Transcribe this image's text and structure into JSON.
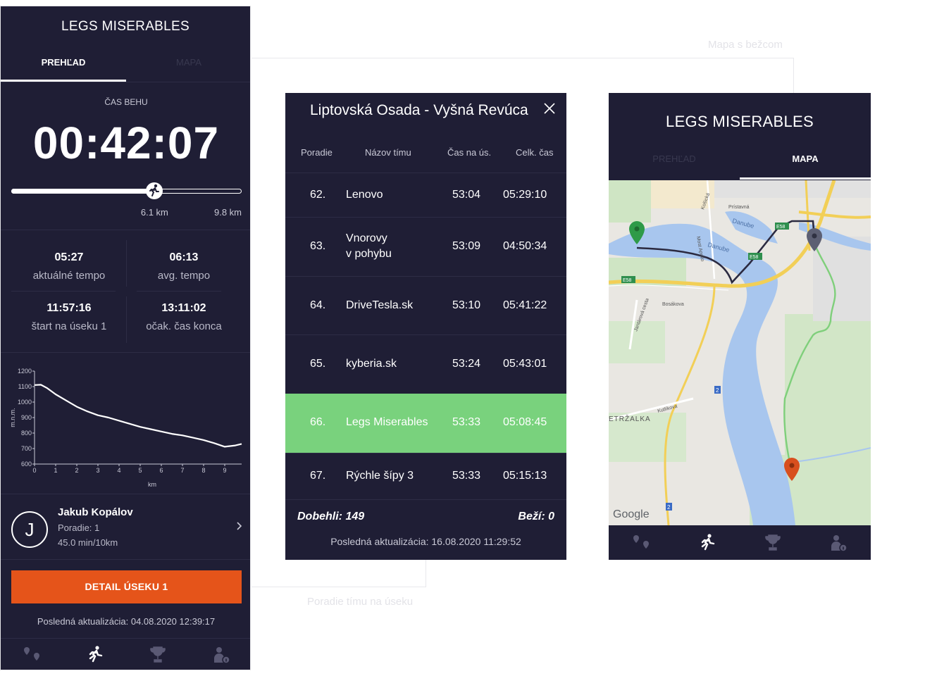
{
  "annotations": {
    "map_label": "Mapa s bežcom",
    "ranking_label": "Poradie tímu na úseku"
  },
  "overview": {
    "title": "LEGS MISERABLES",
    "tabs": [
      "PREHĽAD",
      "MAPA"
    ],
    "run_time_label": "ČAS BEHU",
    "run_time": "00:42:07",
    "progress": {
      "current_km_label": "6.1 km",
      "total_km_label": "9.8 km",
      "fraction": 0.622
    },
    "stats": {
      "pace_current": "05:27",
      "pace_current_label": "aktuálné tempo",
      "pace_avg": "06:13",
      "pace_avg_label": "avg. tempo",
      "start_time": "11:57:16",
      "start_time_label": "štart na úseku 1",
      "expected_end": "13:11:02",
      "expected_end_label": "očak. čas konca"
    },
    "runner": {
      "initial": "J",
      "name": "Jakub Kopálov",
      "rank": "Poradie: 1",
      "pace": "45.0 min/10km"
    },
    "detail_button": "DETAIL ÚSEKU 1",
    "last_update": "Posledná aktualizácia: 04.08.2020 12:39:17",
    "nav_icons": [
      "pins-icon",
      "runner-icon",
      "trophy-icon",
      "person-info-icon"
    ],
    "active_nav": 1
  },
  "chart_data": {
    "type": "line",
    "xlabel": "km",
    "ylabel": "m.n.m.",
    "xlim": [
      0,
      9.8
    ],
    "ylim": [
      600,
      1200
    ],
    "x_ticks": [
      0,
      1,
      2,
      3,
      4,
      5,
      6,
      7,
      8,
      9
    ],
    "y_ticks": [
      600,
      700,
      800,
      900,
      1000,
      1100,
      1200
    ],
    "x": [
      0,
      0.3,
      0.6,
      1,
      1.5,
      2,
      2.5,
      3,
      3.5,
      4,
      4.5,
      5,
      5.5,
      6,
      6.5,
      7,
      7.5,
      8,
      8.5,
      9,
      9.5,
      9.8
    ],
    "values": [
      1110,
      1112,
      1090,
      1050,
      1010,
      970,
      940,
      915,
      900,
      880,
      860,
      840,
      825,
      810,
      795,
      785,
      770,
      755,
      735,
      712,
      720,
      730
    ]
  },
  "ranking": {
    "title": "Liptovská Osada - Vyšná Revúca",
    "headers": [
      "Poradie",
      "Názov tímu",
      "Čas na ús.",
      "Celk. čas"
    ],
    "rows": [
      {
        "rank": "62.",
        "team": "Lenovo",
        "team2": "",
        "segment": "53:04",
        "total": "05:29:10",
        "highlight": false
      },
      {
        "rank": "63.",
        "team": "Vnorovy",
        "team2": "v pohybu",
        "segment": "53:09",
        "total": "04:50:34",
        "highlight": false
      },
      {
        "rank": "64.",
        "team": "DriveTesla.sk",
        "team2": "",
        "segment": "53:10",
        "total": "05:41:22",
        "highlight": false
      },
      {
        "rank": "65.",
        "team": "kyberia.sk",
        "team2": "",
        "segment": "53:24",
        "total": "05:43:01",
        "highlight": false
      },
      {
        "rank": "66.",
        "team": "Legs Miserables",
        "team2": "",
        "segment": "53:33",
        "total": "05:08:45",
        "highlight": true
      },
      {
        "rank": "67.",
        "team": "Rýchle šípy 3",
        "team2": "",
        "segment": "53:33",
        "total": "05:15:13",
        "highlight": false
      }
    ],
    "finished": "Dobehli: 149",
    "running": "Beží: 0",
    "last_update": "Posledná aktualizácia: 16.08.2020 11:29:52"
  },
  "map_view": {
    "title": "LEGS MISERABLES",
    "tabs": [
      "PREHĽAD",
      "MAPA"
    ],
    "labels": {
      "pristavna": "Prístavná",
      "danube1": "Danube",
      "danube2": "Danube",
      "e58a": "E58",
      "e58b": "E58",
      "e58c": "E58",
      "kosicka": "Košická",
      "most": "Most Apollo",
      "bosakova": "Bosákova",
      "jantarova": "Jantárová cesta",
      "petrzalka": "ETRŽALKA",
      "kutlikova": "Kutlíkova",
      "road2a": "2",
      "road2b": "2",
      "google": "Google"
    },
    "nav_icons": [
      "pins-icon",
      "runner-icon",
      "trophy-icon",
      "person-info-icon"
    ],
    "colors": {
      "start_pin": "#2e9a48",
      "runner_pin": "#5c5f73",
      "end_pin": "#d84f1e",
      "route_done": "#2b2a40",
      "route_next": "#7fcf7b"
    }
  }
}
